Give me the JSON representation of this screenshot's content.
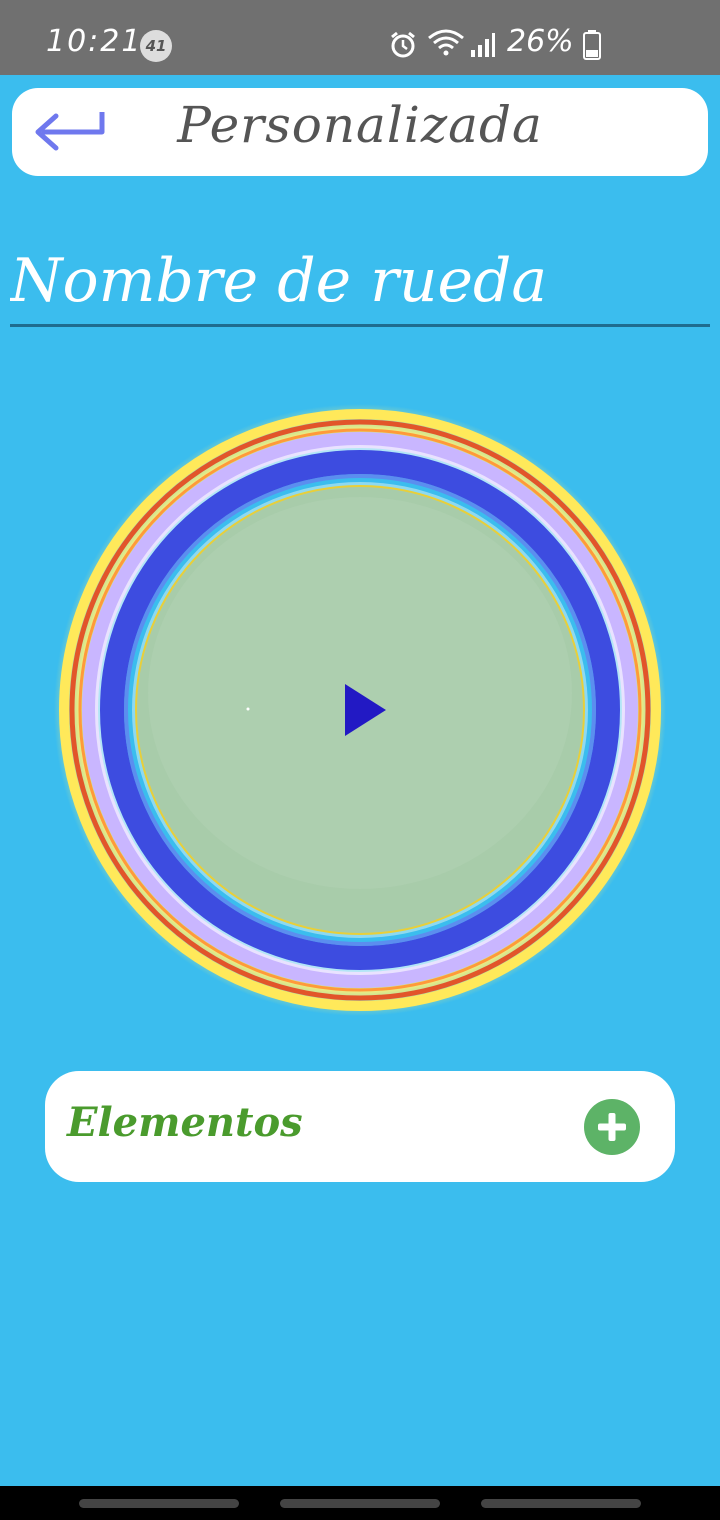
{
  "status_bar": {
    "time": "10:21",
    "notification_count": "41",
    "battery_percent": "26%",
    "icons": [
      "alarm-icon",
      "wifi-icon",
      "signal-icon",
      "battery-icon"
    ]
  },
  "header": {
    "title": "Personalizada",
    "back_icon": "arrow-return-left-icon"
  },
  "wheel_name": {
    "placeholder": "Nombre de rueda",
    "value": ""
  },
  "wheel": {
    "play_icon": "play-icon"
  },
  "elements": {
    "label": "Elementos",
    "add_icon": "plus-circle-icon"
  },
  "colors": {
    "background": "#3bbdee",
    "accent_blue": "#3d4ce0",
    "wheel_fill": "#a8ccaa",
    "elements_label": "#4a9b2d",
    "add_button": "#5db367",
    "play": "#2219c4"
  }
}
